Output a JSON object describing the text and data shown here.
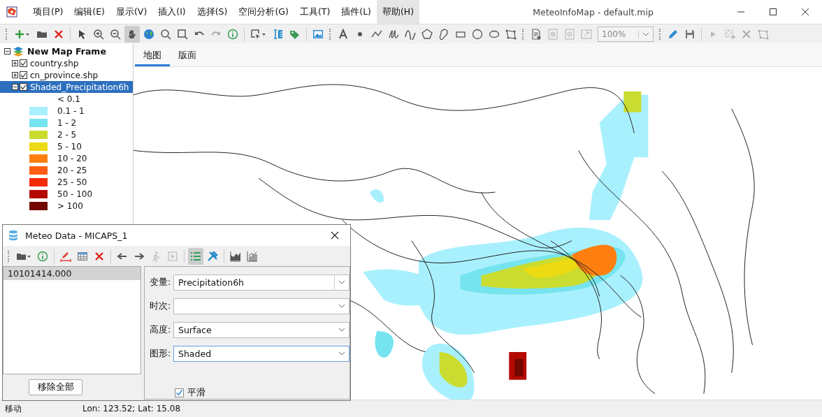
{
  "window": {
    "title": "MeteoInfoMap - default.mip"
  },
  "menu": [
    {
      "label": "项目(P)",
      "selected": false
    },
    {
      "label": "编辑(E)",
      "selected": false
    },
    {
      "label": "显示(V)",
      "selected": false
    },
    {
      "label": "插入(I)",
      "selected": false
    },
    {
      "label": "选择(S)",
      "selected": false
    },
    {
      "label": "空间分析(G)",
      "selected": false
    },
    {
      "label": "工具(T)",
      "selected": false
    },
    {
      "label": "插件(L)",
      "selected": false
    },
    {
      "label": "帮助(H)",
      "selected": true
    }
  ],
  "toolbar": [
    {
      "kind": "grip"
    },
    {
      "kind": "add",
      "selected": false,
      "disabled": false
    },
    {
      "kind": "open",
      "selected": false,
      "disabled": false
    },
    {
      "kind": "remove",
      "selected": false,
      "disabled": false
    },
    {
      "kind": "sep"
    },
    {
      "kind": "pointer",
      "selected": false,
      "disabled": false
    },
    {
      "kind": "zoomin",
      "selected": false,
      "disabled": false
    },
    {
      "kind": "zoomout",
      "selected": false,
      "disabled": false
    },
    {
      "kind": "pan",
      "selected": true,
      "disabled": false
    },
    {
      "kind": "globe",
      "selected": false,
      "disabled": false
    },
    {
      "kind": "search",
      "selected": false,
      "disabled": false
    },
    {
      "kind": "rectzoom",
      "selected": false,
      "disabled": false
    },
    {
      "kind": "undo",
      "selected": false,
      "disabled": false
    },
    {
      "kind": "redo",
      "selected": false,
      "disabled": true
    },
    {
      "kind": "info",
      "selected": false,
      "disabled": false
    },
    {
      "kind": "sep"
    },
    {
      "kind": "selectdrop",
      "selected": false,
      "disabled": false
    },
    {
      "kind": "measure",
      "selected": false,
      "disabled": false
    },
    {
      "kind": "tag",
      "selected": false,
      "disabled": false
    },
    {
      "kind": "sep"
    },
    {
      "kind": "image",
      "selected": false,
      "disabled": false
    },
    {
      "kind": "grip"
    },
    {
      "kind": "text",
      "selected": false,
      "disabled": false
    },
    {
      "kind": "point",
      "selected": false,
      "disabled": false
    },
    {
      "kind": "polyline",
      "selected": false,
      "disabled": false
    },
    {
      "kind": "freehand",
      "selected": false,
      "disabled": false
    },
    {
      "kind": "curve",
      "selected": false,
      "disabled": false
    },
    {
      "kind": "polygon",
      "selected": false,
      "disabled": false
    },
    {
      "kind": "blob",
      "selected": false,
      "disabled": false
    },
    {
      "kind": "rectangle",
      "selected": false,
      "disabled": false
    },
    {
      "kind": "circle",
      "selected": false,
      "disabled": false
    },
    {
      "kind": "ellipse",
      "selected": false,
      "disabled": false
    },
    {
      "kind": "vertices",
      "selected": false,
      "disabled": false
    },
    {
      "kind": "grip"
    },
    {
      "kind": "pagesetup",
      "selected": false,
      "disabled": false
    },
    {
      "kind": "pagezoomin",
      "selected": false,
      "disabled": true
    },
    {
      "kind": "pagezoomout",
      "selected": false,
      "disabled": true
    },
    {
      "kind": "fitpage",
      "selected": false,
      "disabled": true
    },
    {
      "kind": "zoomcombo",
      "value": "100%"
    },
    {
      "kind": "grip"
    },
    {
      "kind": "pencil",
      "selected": false,
      "disabled": false
    },
    {
      "kind": "save",
      "selected": false,
      "disabled": false
    },
    {
      "kind": "sep"
    },
    {
      "kind": "play",
      "selected": false,
      "disabled": true
    },
    {
      "kind": "addfeature",
      "selected": false,
      "disabled": true
    },
    {
      "kind": "close",
      "selected": false,
      "disabled": true
    },
    {
      "kind": "vertices",
      "selected": false,
      "disabled": true
    }
  ],
  "layers": {
    "root": {
      "label": "New Map Frame",
      "expanded": true
    },
    "items": [
      {
        "label": "country.shp",
        "checked": true,
        "expanded": false,
        "selected": false
      },
      {
        "label": "cn_province.shp",
        "checked": true,
        "expanded": false,
        "selected": false
      },
      {
        "label": "Shaded_Precipitation6h",
        "checked": true,
        "expanded": true,
        "selected": true,
        "legend": [
          {
            "label": "< 0.1"
          },
          {
            "label": "0.1 - 1",
            "color": "#a9f0fe"
          },
          {
            "label": "1 - 2",
            "color": "#76e4ee"
          },
          {
            "label": "2 - 5",
            "color": "#cadc30"
          },
          {
            "label": "5 - 10",
            "color": "#ecda12"
          },
          {
            "label": "10 - 20",
            "color": "#fe7f10"
          },
          {
            "label": "20 - 25",
            "color": "#fe5e14"
          },
          {
            "label": "25 - 50",
            "color": "#f42a08"
          },
          {
            "label": "50 - 100",
            "color": "#b40a02"
          },
          {
            "label": "> 100",
            "color": "#720800"
          }
        ]
      }
    ]
  },
  "tabs": [
    {
      "label": "地图",
      "selected": true
    },
    {
      "label": "版面",
      "selected": false
    }
  ],
  "dialog": {
    "title": "Meteo Data - MICAPS_1",
    "toolbar": [
      {
        "kind": "grip"
      },
      {
        "kind": "openfolder",
        "selected": false,
        "disabled": false
      },
      {
        "kind": "info",
        "selected": false,
        "disabled": false
      },
      {
        "kind": "sep"
      },
      {
        "kind": "edit",
        "selected": false,
        "disabled": false
      },
      {
        "kind": "table",
        "selected": false,
        "disabled": false
      },
      {
        "kind": "remove",
        "selected": false,
        "disabled": false
      },
      {
        "kind": "sep"
      },
      {
        "kind": "back",
        "selected": false,
        "disabled": false
      },
      {
        "kind": "forward",
        "selected": false,
        "disabled": false
      },
      {
        "kind": "walk",
        "selected": false,
        "disabled": true
      },
      {
        "kind": "frame",
        "selected": false,
        "disabled": true
      },
      {
        "kind": "sep"
      },
      {
        "kind": "list",
        "selected": true,
        "disabled": false
      },
      {
        "kind": "tools",
        "selected": false,
        "disabled": false
      },
      {
        "kind": "sep"
      },
      {
        "kind": "areachart",
        "selected": false,
        "disabled": false
      },
      {
        "kind": "barchart",
        "selected": false,
        "disabled": false
      }
    ],
    "files": [
      {
        "label": "10101414.000",
        "selected": true
      }
    ],
    "remove_button": "移除全部",
    "fields": [
      {
        "label": "变量:",
        "value": "Precipitation6h",
        "focused": false
      },
      {
        "label": "时次:",
        "focused": false
      },
      {
        "label": "高度:",
        "value": "Surface",
        "focused": false
      },
      {
        "label": "图形:",
        "value": "Shaded",
        "focused": true
      }
    ],
    "smooth": {
      "label": "平滑",
      "checked": true
    }
  },
  "status_bar": {
    "mode": "移动",
    "position": "Lon: 123.52; Lat: 15.08"
  }
}
